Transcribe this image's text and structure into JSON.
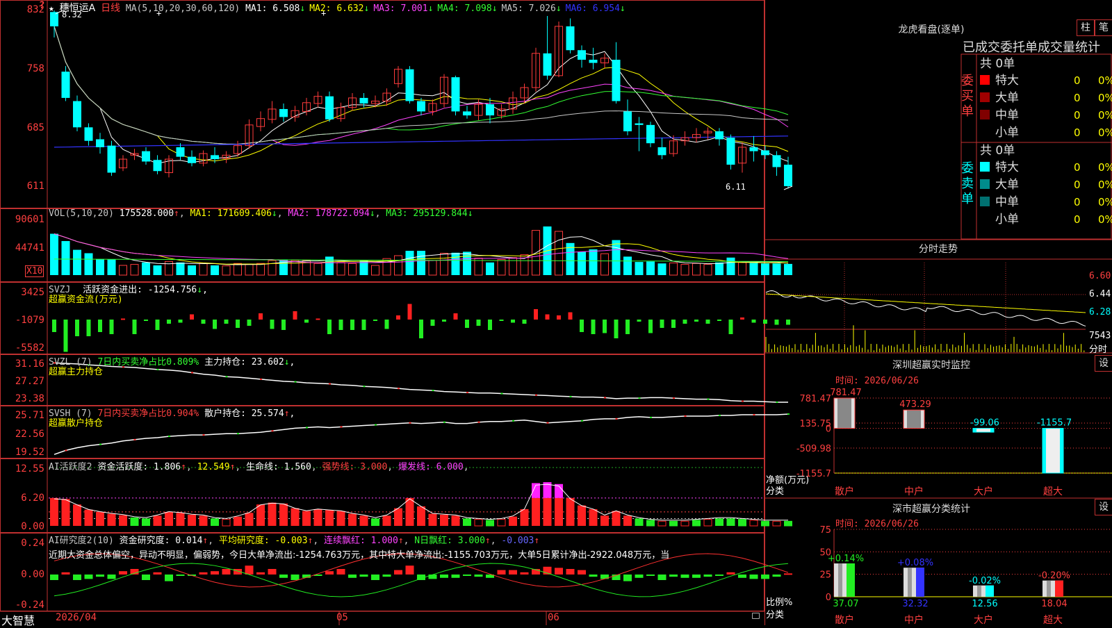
{
  "main_panel": {
    "star_icon": "★",
    "stock_name": "穗恒运A",
    "period": "日线",
    "ma_label": "MA(5,10,20,30,60,120)",
    "ma_values": [
      {
        "label": "MA1:",
        "value": "6.508",
        "arrow": "↓",
        "color": "#ffffff"
      },
      {
        "label": "MA2:",
        "value": "6.632",
        "arrow": "↓",
        "color": "#ffff00"
      },
      {
        "label": "MA3:",
        "value": "7.001",
        "arrow": "↓",
        "color": "#ff44ff"
      },
      {
        "label": "MA4:",
        "value": "7.098",
        "arrow": "↓",
        "color": "#33ff33"
      },
      {
        "label": "MA5:",
        "value": "7.026",
        "arrow": "↓",
        "color": "#c8c8c8"
      },
      {
        "label": "MA6:",
        "value": "6.954",
        "arrow": "↓",
        "color": "#3333ff"
      }
    ],
    "y_ticks": [
      "832",
      "758",
      "685",
      "611"
    ],
    "high_label": "8.32",
    "low_label": "6.11",
    "question": "?",
    "markers": [
      "+",
      "+"
    ]
  },
  "vol_panel": {
    "label": "VOL(5,10,20)",
    "value": "175528.000",
    "ma1": "MA1: 171609.406",
    "ma2": "MA2: 178722.094",
    "ma3": "MA3: 295129.844",
    "y_ticks": [
      "90601",
      "44741"
    ],
    "unit": "X10"
  },
  "svzj_panel": {
    "label": "SVZJ",
    "text1": "活跃资金进出: -1254.756",
    "text2": "超赢资金流(万元)",
    "y_ticks": [
      "3425",
      "-1079",
      "-5582"
    ]
  },
  "svzl_panel": {
    "label": "SVZL (7)",
    "text1": "7日内买卖净占比0.809%",
    "text2": "主力持仓: 23.602",
    "text3": "超赢主力持仓",
    "y_ticks": [
      "31.16",
      "27.27",
      "23.38"
    ]
  },
  "svsh_panel": {
    "label": "SVSH (7)",
    "text1": "7日内买卖净占比0.904%",
    "text2": "散户持仓: 25.574",
    "text3": "超赢散户持仓",
    "y_ticks": [
      "25.71",
      "22.56",
      "19.52"
    ]
  },
  "ai_active_panel": {
    "label": "AI活跃度2",
    "v1": "资金活跃度: 1.806",
    "v2": "12.549",
    "v3": "生命线: 1.560",
    "v4": "强势线: 3.000",
    "v5": "爆发线: 6.000",
    "y_ticks": [
      "12.55",
      "6.20",
      "0.00"
    ]
  },
  "ai_research_panel": {
    "label": "AI研究度2(10)",
    "v1": "资金研究度: 0.014",
    "v2": "平均研究度: -0.003",
    "v3": "连续飘红: 1.000",
    "v4": "N日飘红: 3.000",
    "v5": "-0.003",
    "desc": "近期大资金总体偏空，异动不明显，偏弱势，今日大单净流出:-1254.763万元，其中特大单净流出:-1155.703万元，大单5日累计净出-2922.048万元，当",
    "y_ticks": [
      "0.24",
      "0.00",
      "-0.24"
    ]
  },
  "bottom_bar": {
    "brand": "大智慧",
    "dates": [
      "2026/04",
      "05",
      "06"
    ]
  },
  "right_panel": {
    "title": "龙虎看盘(逐单)",
    "btn1": "柱",
    "btn2": "笔",
    "subtitle": "已成交委托单成交量统计",
    "buy": {
      "side_label": "委买单",
      "total": "共 0单",
      "rows": [
        {
          "name": "特大",
          "count": "0",
          "pct": "0%",
          "color": "#ff0000"
        },
        {
          "name": "大单",
          "count": "0",
          "pct": "0%",
          "color": "#a00000"
        },
        {
          "name": "中单",
          "count": "0",
          "pct": "0%",
          "color": "#800000"
        },
        {
          "name": "小单",
          "count": "0",
          "pct": "0%",
          "color": ""
        }
      ]
    },
    "sell": {
      "side_label": "委卖单",
      "total": "共 0单",
      "rows": [
        {
          "name": "特大",
          "count": "0",
          "pct": "0%",
          "color": "#00ffff"
        },
        {
          "name": "大单",
          "count": "0",
          "pct": "0%",
          "color": "#008b8b"
        },
        {
          "name": "中单",
          "count": "0",
          "pct": "0%",
          "color": "#007070"
        },
        {
          "name": "小单",
          "count": "0",
          "pct": "0%",
          "color": ""
        }
      ]
    },
    "fenshi": {
      "title": "分时走势",
      "y_ticks": [
        "6.60",
        "6.44",
        "6.28"
      ],
      "vol_label": "7543",
      "unit": "分时"
    },
    "monitor": {
      "title": "深圳超赢实时监控",
      "btn": "设",
      "time": "时间: 2026/06/26",
      "y_ticks": [
        "781.47",
        "135.75",
        "0",
        "-509.98",
        "-1155.7"
      ],
      "unit1": "净额(万元)",
      "unit2": "分类",
      "bars": [
        {
          "cat": "散户",
          "label": "781.47",
          "value": 781.47
        },
        {
          "cat": "中户",
          "label": "473.29",
          "value": 473.29
        },
        {
          "cat": "大户",
          "label": "-99.06",
          "value": -99.06
        },
        {
          "cat": "超大",
          "label": "-1155.7",
          "value": -1155.7
        }
      ]
    },
    "classify": {
      "title": "深市超赢分类统计",
      "btn": "设",
      "time": "时间: 2026/06/26",
      "y_ticks": [
        "75",
        "50",
        "25",
        "0"
      ],
      "unit1": "比例%",
      "unit2": "分类",
      "bars": [
        {
          "cat": "散户",
          "label": "+0.14%",
          "value": 37.07,
          "value_label": "37.07"
        },
        {
          "cat": "中户",
          "label": "+0.08%",
          "value": 32.32,
          "value_label": "32.32"
        },
        {
          "cat": "大户",
          "label": "-0.02%",
          "value": 12.56,
          "value_label": "12.56"
        },
        {
          "cat": "超大",
          "label": "-0.20%",
          "value": 18.04,
          "value_label": "18.04"
        }
      ]
    }
  },
  "chart_data": {
    "type": "candlestick",
    "candles": [
      [
        8.3,
        8.12,
        8.32,
        7.98
      ],
      [
        7.55,
        7.22,
        7.62,
        7.18
      ],
      [
        7.18,
        6.85,
        7.25,
        6.8
      ],
      [
        6.85,
        6.68,
        6.9,
        6.62
      ],
      [
        6.7,
        6.6,
        6.78,
        6.52
      ],
      [
        6.62,
        6.28,
        6.68,
        6.24
      ],
      [
        6.34,
        6.45,
        6.5,
        6.3
      ],
      [
        6.5,
        6.52,
        6.58,
        6.44
      ],
      [
        6.55,
        6.42,
        6.6,
        6.38
      ],
      [
        6.44,
        6.3,
        6.5,
        6.26
      ],
      [
        6.28,
        6.45,
        6.5,
        6.22
      ],
      [
        6.6,
        6.48,
        6.65,
        6.44
      ],
      [
        6.48,
        6.4,
        6.56,
        6.36
      ],
      [
        6.4,
        6.52,
        6.56,
        6.36
      ],
      [
        6.5,
        6.45,
        6.6,
        6.4
      ],
      [
        6.46,
        6.5,
        6.55,
        6.4
      ],
      [
        6.52,
        6.62,
        6.68,
        6.48
      ],
      [
        6.62,
        6.88,
        6.95,
        6.58
      ],
      [
        6.86,
        6.96,
        7.05,
        6.8
      ],
      [
        6.95,
        7.08,
        7.18,
        6.9
      ],
      [
        7.08,
        6.98,
        7.15,
        6.92
      ],
      [
        6.98,
        7.06,
        7.12,
        6.92
      ],
      [
        7.05,
        7.16,
        7.22,
        7.0
      ],
      [
        7.15,
        7.24,
        7.3,
        7.1
      ],
      [
        7.24,
        6.95,
        7.3,
        6.92
      ],
      [
        6.96,
        7.1,
        7.16,
        6.92
      ],
      [
        7.1,
        7.22,
        7.28,
        7.06
      ],
      [
        7.22,
        7.15,
        7.28,
        7.1
      ],
      [
        7.15,
        7.18,
        7.25,
        7.1
      ],
      [
        7.18,
        7.28,
        7.34,
        7.12
      ],
      [
        7.4,
        7.58,
        7.62,
        7.35
      ],
      [
        7.58,
        7.18,
        7.62,
        7.15
      ],
      [
        7.18,
        7.05,
        7.22,
        7.0
      ],
      [
        7.05,
        7.15,
        7.2,
        7.0
      ],
      [
        7.15,
        7.48,
        7.52,
        7.1
      ],
      [
        7.48,
        7.05,
        7.5,
        7.0
      ],
      [
        7.05,
        7.0,
        7.12,
        6.96
      ],
      [
        7.0,
        7.14,
        7.2,
        6.94
      ],
      [
        7.14,
        7.0,
        7.22,
        6.9
      ],
      [
        7.0,
        7.08,
        7.14,
        6.96
      ],
      [
        7.08,
        7.22,
        7.3,
        7.02
      ],
      [
        7.22,
        7.35,
        7.4,
        7.15
      ],
      [
        7.35,
        7.78,
        7.85,
        7.3
      ],
      [
        7.78,
        7.5,
        8.25,
        7.45
      ],
      [
        7.5,
        8.12,
        8.18,
        7.48
      ],
      [
        8.12,
        7.82,
        8.22,
        7.78
      ],
      [
        7.82,
        7.7,
        7.88,
        7.6
      ],
      [
        7.7,
        7.66,
        7.85,
        7.58
      ],
      [
        7.66,
        7.72,
        7.78,
        7.6
      ],
      [
        7.7,
        7.18,
        7.92,
        7.15
      ],
      [
        7.05,
        6.8,
        7.2,
        6.75
      ],
      [
        6.9,
        6.88,
        6.98,
        6.55
      ],
      [
        6.88,
        6.65,
        6.92,
        6.6
      ],
      [
        6.6,
        6.5,
        6.72,
        6.45
      ],
      [
        6.52,
        6.68,
        6.75,
        6.48
      ],
      [
        6.68,
        6.72,
        6.8,
        6.62
      ],
      [
        6.72,
        6.76,
        6.84,
        6.66
      ],
      [
        6.78,
        6.8,
        6.85,
        6.7
      ],
      [
        6.8,
        6.7,
        6.84,
        6.62
      ],
      [
        6.72,
        6.38,
        6.76,
        6.32
      ],
      [
        6.4,
        6.6,
        6.66,
        6.28
      ],
      [
        6.6,
        6.55,
        6.74,
        6.42
      ],
      [
        6.56,
        6.5,
        6.62,
        6.45
      ],
      [
        6.5,
        6.35,
        6.55,
        6.24
      ],
      [
        6.38,
        6.11,
        6.48,
        6.08
      ]
    ],
    "vol_ratio": [
      0.85,
      0.7,
      0.52,
      0.45,
      0.33,
      0.32,
      0.2,
      0.22,
      0.26,
      0.2,
      0.28,
      0.26,
      0.2,
      0.24,
      0.2,
      0.19,
      0.24,
      0.22,
      0.24,
      0.3,
      0.32,
      0.3,
      0.3,
      0.24,
      0.38,
      0.26,
      0.24,
      0.3,
      0.2,
      0.34,
      0.4,
      0.5,
      0.5,
      0.3,
      0.45,
      0.46,
      0.48,
      0.35,
      0.26,
      0.32,
      0.36,
      0.42,
      0.92,
      1.0,
      0.9,
      0.66,
      0.48,
      0.53,
      0.44,
      0.72,
      0.38,
      0.27,
      0.28,
      0.24,
      0.25,
      0.22,
      0.24,
      0.22,
      0.26,
      0.36,
      0.26,
      0.25,
      0.24,
      0.24,
      0.23
    ],
    "svzj": [
      -0.6,
      -1.55,
      -0.8,
      -0.8,
      -0.6,
      -0.7,
      0.05,
      -0.7,
      -0.05,
      -0.5,
      -0.2,
      -0.15,
      0.25,
      -0.2,
      -0.45,
      -0.2,
      -0.4,
      -0.3,
      0.3,
      -0.45,
      -0.5,
      0.4,
      -0.15,
      0.05,
      -0.7,
      -0.5,
      -0.5,
      -0.5,
      -0.05,
      -0.45,
      0.2,
      0.75,
      -0.9,
      -0.3,
      -0.1,
      0.3,
      -0.4,
      -0.3,
      -0.5,
      -0.05,
      -0.15,
      -0.2,
      0.5,
      0.25,
      0.2,
      0.35,
      -0.6,
      -0.7,
      -0.65,
      -0.9,
      -0.7,
      -0.1,
      -0.65,
      -0.4,
      -0.4,
      -0.2,
      -0.1,
      -0.2,
      -0.05,
      -0.7,
      0.1,
      -0.15,
      -0.2,
      -0.25,
      -0.25
    ],
    "svzl": [
      30.7,
      30.6,
      30.5,
      30.3,
      30.2,
      30.0,
      29.9,
      29.8,
      29.6,
      29.4,
      29.3,
      29.1,
      28.8,
      28.5,
      28.3,
      28.0,
      27.9,
      27.7,
      27.5,
      27.3,
      27.1,
      27.0,
      26.8,
      26.7,
      26.6,
      26.4,
      26.3,
      26.1,
      26.0,
      25.9,
      25.7,
      25.5,
      25.4,
      25.3,
      25.1,
      25.0,
      24.9,
      24.8,
      24.8,
      24.7,
      24.6,
      24.5,
      24.4,
      24.3,
      24.2,
      24.1,
      24.0,
      24.0,
      23.9,
      23.7,
      23.8,
      23.8,
      23.9,
      23.9,
      23.8,
      23.7,
      23.6,
      23.6,
      23.5,
      23.3,
      23.2,
      23.2,
      23.1,
      23.0,
      23.0
    ],
    "svsh": [
      19.6,
      20.2,
      20.6,
      20.9,
      21.1,
      21.3,
      21.6,
      21.8,
      22.0,
      22.1,
      22.3,
      22.4,
      22.5,
      22.5,
      22.6,
      22.7,
      22.7,
      22.8,
      22.9,
      23.1,
      23.3,
      23.5,
      23.6,
      23.7,
      23.6,
      23.7,
      23.8,
      23.9,
      24.0,
      24.1,
      24.2,
      24.3,
      24.2,
      24.3,
      24.4,
      24.2,
      24.2,
      24.4,
      24.5,
      24.5,
      24.6,
      24.7,
      24.5,
      24.3,
      24.4,
      24.5,
      24.6,
      24.8,
      24.9,
      24.9,
      25.1,
      25.2,
      25.1,
      25.1,
      25.2,
      25.3,
      25.3,
      25.3,
      25.4,
      25.4,
      25.5,
      25.5,
      25.5,
      25.5,
      25.6
    ],
    "ai_active": [
      6.0,
      5.8,
      4.6,
      3.5,
      3.0,
      2.6,
      2.3,
      1.8,
      1.6,
      2.2,
      3.0,
      2.8,
      2.4,
      2.2,
      1.6,
      1.4,
      2.0,
      2.8,
      4.6,
      5.0,
      4.8,
      3.8,
      3.2,
      3.6,
      3.4,
      3.2,
      2.6,
      2.2,
      1.6,
      2.2,
      3.8,
      6.0,
      4.2,
      2.6,
      2.4,
      2.2,
      1.6,
      1.4,
      1.2,
      1.4,
      2.0,
      3.6,
      9.2,
      9.4,
      9.0,
      6.0,
      4.4,
      3.6,
      2.2,
      3.2,
      2.2,
      1.6,
      1.2,
      1.0,
      1.0,
      1.0,
      1.2,
      1.4,
      1.6,
      1.6,
      1.4,
      1.2,
      1.0,
      1.0,
      1.0
    ],
    "ai_research": [
      -0.05,
      0.02,
      -0.05,
      -0.04,
      -0.02,
      -0.04,
      0.03,
      0.05,
      -0.05,
      0.02,
      -0.06,
      0.0,
      -0.01,
      0.02,
      0.03,
      0.05,
      0.05,
      0.08,
      0.02,
      0.05,
      -0.03,
      -0.05,
      -0.03,
      -0.01,
      0.03,
      0.05,
      -0.03,
      -0.02,
      -0.05,
      -0.02,
      0.04,
      0.08,
      -0.05,
      -0.04,
      -0.03,
      -0.03,
      0.0,
      -0.02,
      -0.03,
      0.04,
      0.04,
      0.02,
      0.05,
      0.07,
      0.06,
      0.05,
      0.04,
      -0.02,
      -0.04,
      -0.05,
      -0.06,
      -0.03,
      -0.01,
      -0.05,
      -0.02,
      -0.03,
      -0.03,
      -0.02,
      -0.01,
      0.02,
      -0.03,
      -0.04,
      -0.04,
      -0.02,
      0.01
    ]
  }
}
